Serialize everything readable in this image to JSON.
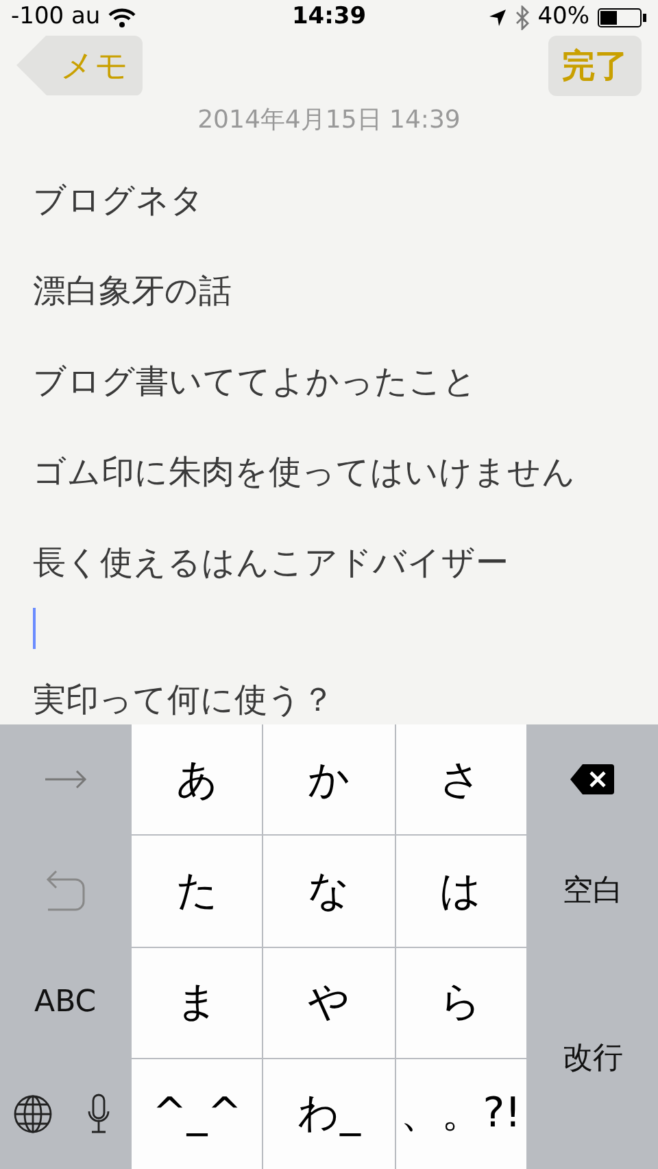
{
  "status_bar": {
    "carrier": "-100 au",
    "time": "14:39",
    "battery": "40%"
  },
  "nav": {
    "back": "メモ",
    "done": "完了"
  },
  "note": {
    "date": "2014年4月15日 14:39",
    "lines": [
      {
        "kind": "text",
        "text": "ブログネタ"
      },
      {
        "kind": "text",
        "text": "漂白象牙の話"
      },
      {
        "kind": "text",
        "text": "ブログ書いててよかったこと"
      },
      {
        "kind": "text",
        "text": "ゴム印に朱肉を使ってはいけません"
      },
      {
        "kind": "text",
        "text": "長く使えるはんこアドバイザー"
      },
      {
        "kind": "cursor"
      },
      {
        "kind": "text",
        "text": "実印って何に使う？"
      }
    ]
  },
  "keyboard": {
    "keys": [
      {
        "kind": "next"
      },
      {
        "kind": "char",
        "label": "あ"
      },
      {
        "kind": "char",
        "label": "か"
      },
      {
        "kind": "char",
        "label": "さ"
      },
      {
        "kind": "delete"
      },
      {
        "kind": "undo"
      },
      {
        "kind": "char",
        "label": "た"
      },
      {
        "kind": "char",
        "label": "な"
      },
      {
        "kind": "char",
        "label": "は"
      },
      {
        "kind": "func",
        "label": "空白"
      },
      {
        "kind": "func",
        "label": "ABC"
      },
      {
        "kind": "char",
        "label": "ま"
      },
      {
        "kind": "char",
        "label": "や"
      },
      {
        "kind": "char",
        "label": "ら"
      },
      {
        "kind": "return",
        "label": "改行"
      },
      {
        "kind": "globe"
      },
      {
        "kind": "mic"
      },
      {
        "kind": "char",
        "label": "^_^"
      },
      {
        "kind": "char",
        "label": "わ_"
      },
      {
        "kind": "char",
        "label": "、。?!"
      }
    ]
  }
}
